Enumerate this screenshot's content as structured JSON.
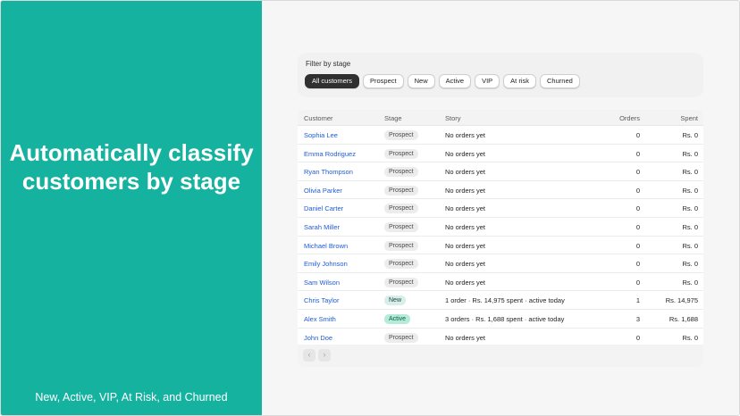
{
  "hero": {
    "title": "Automatically classify customers by stage",
    "subtitle": "New, Active, VIP, At Risk, and Churned",
    "background": "#16b2a0"
  },
  "filter": {
    "label": "Filter by stage",
    "options": [
      "All customers",
      "Prospect",
      "New",
      "Active",
      "VIP",
      "At risk",
      "Churned"
    ],
    "selected": "All customers"
  },
  "table": {
    "headers": {
      "customer": "Customer",
      "stage": "Stage",
      "story": "Story",
      "orders": "Orders",
      "spent": "Spent"
    },
    "rows": [
      {
        "name": "Sophia Lee",
        "stage": "Prospect",
        "story": "No orders yet",
        "orders": "0",
        "spent": "Rs. 0"
      },
      {
        "name": "Emma Rodriguez",
        "stage": "Prospect",
        "story": "No orders yet",
        "orders": "0",
        "spent": "Rs. 0"
      },
      {
        "name": "Ryan Thompson",
        "stage": "Prospect",
        "story": "No orders yet",
        "orders": "0",
        "spent": "Rs. 0"
      },
      {
        "name": "Olivia Parker",
        "stage": "Prospect",
        "story": "No orders yet",
        "orders": "0",
        "spent": "Rs. 0"
      },
      {
        "name": "Daniel Carter",
        "stage": "Prospect",
        "story": "No orders yet",
        "orders": "0",
        "spent": "Rs. 0"
      },
      {
        "name": "Sarah Miller",
        "stage": "Prospect",
        "story": "No orders yet",
        "orders": "0",
        "spent": "Rs. 0"
      },
      {
        "name": "Michael Brown",
        "stage": "Prospect",
        "story": "No orders yet",
        "orders": "0",
        "spent": "Rs. 0"
      },
      {
        "name": "Emily Johnson",
        "stage": "Prospect",
        "story": "No orders yet",
        "orders": "0",
        "spent": "Rs. 0"
      },
      {
        "name": "Sam Wilson",
        "stage": "Prospect",
        "story": "No orders yet",
        "orders": "0",
        "spent": "Rs. 0"
      },
      {
        "name": "Chris Taylor",
        "stage": "New",
        "story": "1 order · Rs. 14,975 spent · active today",
        "orders": "1",
        "spent": "Rs. 14,975"
      },
      {
        "name": "Alex Smith",
        "stage": "Active",
        "story": "3 orders · Rs. 1,688 spent · active today",
        "orders": "3",
        "spent": "Rs. 1,688"
      },
      {
        "name": "John Doe",
        "stage": "Prospect",
        "story": "No orders yet",
        "orders": "0",
        "spent": "Rs. 0"
      }
    ]
  },
  "pagination": {
    "prev_icon": "chevron-left-icon",
    "next_icon": "chevron-right-icon"
  },
  "colors": {
    "link": "#1f5bd8",
    "active_pill": "#303030",
    "badge_new": "#d9eee8",
    "badge_active": "#b4ecd9"
  }
}
